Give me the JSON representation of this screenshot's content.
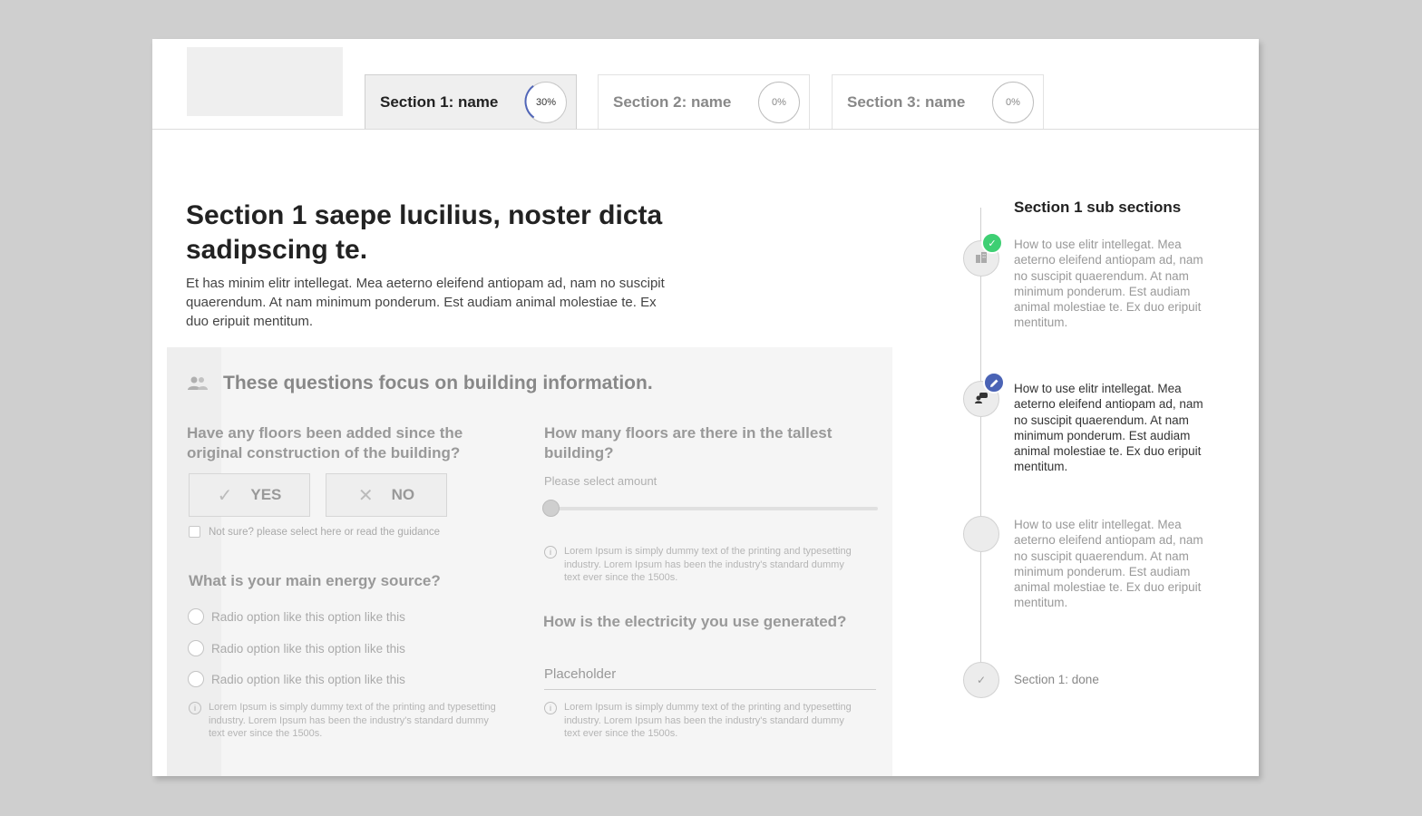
{
  "tabs": [
    {
      "label": "Section 1: name",
      "progress": "30%",
      "progress_value": 0.3
    },
    {
      "label": "Section 2: name",
      "progress": "0%",
      "progress_value": 0
    },
    {
      "label": "Section 3: name",
      "progress": "0%",
      "progress_value": 0
    }
  ],
  "main": {
    "title": "Section 1 saepe lucilius, noster dicta sadipscing te.",
    "intro": "Et has minim elitr intellegat. Mea aeterno eleifend antiopam ad, nam no suscipit quaerendum. At nam minimum ponderum. Est audiam animal molestiae te. Ex duo eripuit mentitum."
  },
  "panel": {
    "title": "These questions focus on building information.",
    "q_floors_added": "Have any floors been added since the original construction of the building?",
    "yes_label": "YES",
    "no_label": "NO",
    "not_sure": "Not sure? please select here or read the guidance",
    "q_energy": "What is your main energy source?",
    "radio_options": [
      "Radio option like this option like this",
      "Radio option like this option like this",
      "Radio option like this option like this"
    ],
    "help_text": "Lorem Ipsum is simply dummy text of the printing and typesetting industry. Lorem Ipsum has been the industry's standard dummy text ever since the 1500s.",
    "q_floors_count": "How many floors are there in the tallest building?",
    "slider_hint": "Please select amount",
    "slider_value": 0,
    "q_electricity": "How is the electricity you use generated?",
    "electricity_placeholder": "Placeholder"
  },
  "sidebar": {
    "title": "Section 1 sub sections",
    "steps": [
      {
        "text": "How to use elitr intellegat. Mea aeterno eleifend antiopam ad, nam no suscipit quaerendum. At nam minimum ponderum. Est audiam animal molestiae te. Ex duo eripuit mentitum.",
        "status": "complete",
        "icon": "building-icon"
      },
      {
        "text": "How to use elitr intellegat. Mea aeterno eleifend antiopam ad, nam no suscipit quaerendum. At nam minimum ponderum. Est audiam animal molestiae te. Ex duo eripuit mentitum.",
        "status": "in-progress",
        "icon": "user-chat-icon"
      },
      {
        "text": "How to use elitr intellegat. Mea aeterno eleifend antiopam ad, nam no suscipit quaerendum. At nam minimum ponderum. Est audiam animal molestiae te. Ex duo eripuit mentitum.",
        "status": "pending",
        "icon": ""
      }
    ],
    "done_label": "Section 1: done"
  },
  "colors": {
    "complete": "#3ecf73",
    "in_progress": "#4a63b5",
    "progress_ring": "#5166b8"
  }
}
